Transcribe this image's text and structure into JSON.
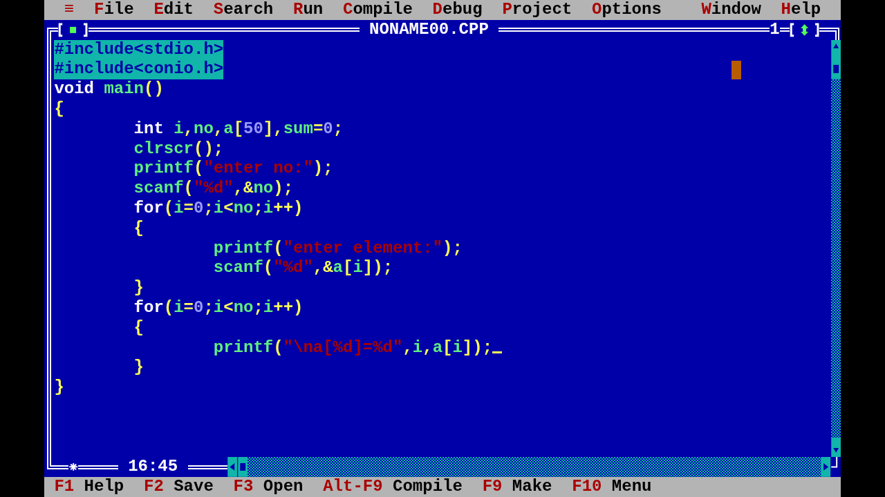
{
  "menu_bar": {
    "items": [
      {
        "label": "≡"
      },
      {
        "label": "File"
      },
      {
        "label": "Edit"
      },
      {
        "label": "Search"
      },
      {
        "label": "Run"
      },
      {
        "label": "Compile"
      },
      {
        "label": "Debug"
      },
      {
        "label": "Project"
      },
      {
        "label": "Options"
      },
      {
        "label": "Window"
      },
      {
        "label": "Help"
      }
    ]
  },
  "window": {
    "title": "NONAME00.CPP",
    "number": "1",
    "modified": true,
    "cursor_position": "16:45"
  },
  "code": {
    "lines": [
      {
        "selected": true,
        "cursor": false,
        "tokens": [
          {
            "kind": "dir",
            "text": "#include<stdio.h>"
          }
        ]
      },
      {
        "selected": true,
        "cursor": false,
        "tokens": [
          {
            "kind": "dir",
            "text": "#include<conio.h>"
          }
        ]
      },
      {
        "selected": false,
        "cursor": false,
        "tokens": [
          {
            "kind": "kw",
            "text": "void"
          },
          {
            "kind": "id",
            "text": " main"
          },
          {
            "kind": "sym",
            "text": "()"
          }
        ]
      },
      {
        "selected": false,
        "cursor": false,
        "tokens": [
          {
            "kind": "sym",
            "text": "{"
          }
        ],
        "children": [
          {
            "selected": false,
            "cursor": false,
            "tokens": [
              {
                "kind": "kw",
                "text": "int"
              },
              {
                "kind": "id",
                "text": " i"
              },
              {
                "kind": "sym",
                "text": ","
              },
              {
                "kind": "id",
                "text": "no"
              },
              {
                "kind": "sym",
                "text": ","
              },
              {
                "kind": "id",
                "text": "a"
              },
              {
                "kind": "sym",
                "text": "["
              },
              {
                "kind": "num",
                "text": "50"
              },
              {
                "kind": "sym",
                "text": "],"
              },
              {
                "kind": "id",
                "text": "sum"
              },
              {
                "kind": "sym",
                "text": "="
              },
              {
                "kind": "num",
                "text": "0"
              },
              {
                "kind": "sym",
                "text": ";"
              }
            ]
          },
          {
            "selected": false,
            "cursor": false,
            "tokens": [
              {
                "kind": "id",
                "text": "clrscr"
              },
              {
                "kind": "sym",
                "text": "();"
              }
            ]
          },
          {
            "selected": false,
            "cursor": false,
            "tokens": [
              {
                "kind": "id",
                "text": "printf"
              },
              {
                "kind": "sym",
                "text": "("
              },
              {
                "kind": "str",
                "text": "\"enter no:\""
              },
              {
                "kind": "sym",
                "text": ");"
              }
            ]
          },
          {
            "selected": false,
            "cursor": false,
            "tokens": [
              {
                "kind": "id",
                "text": "scanf"
              },
              {
                "kind": "sym",
                "text": "("
              },
              {
                "kind": "str",
                "text": "\"%d\""
              },
              {
                "kind": "sym",
                "text": ",&"
              },
              {
                "kind": "id",
                "text": "no"
              },
              {
                "kind": "sym",
                "text": ");"
              }
            ]
          },
          {
            "selected": false,
            "cursor": false,
            "tokens": [
              {
                "kind": "kw",
                "text": "for"
              },
              {
                "kind": "sym",
                "text": "("
              },
              {
                "kind": "id",
                "text": "i"
              },
              {
                "kind": "sym",
                "text": "="
              },
              {
                "kind": "num",
                "text": "0"
              },
              {
                "kind": "sym",
                "text": ";"
              },
              {
                "kind": "id",
                "text": "i"
              },
              {
                "kind": "sym",
                "text": "<"
              },
              {
                "kind": "id",
                "text": "no"
              },
              {
                "kind": "sym",
                "text": ";"
              },
              {
                "kind": "id",
                "text": "i"
              },
              {
                "kind": "sym",
                "text": "++)"
              }
            ]
          },
          {
            "selected": false,
            "cursor": false,
            "tokens": [
              {
                "kind": "sym",
                "text": "{"
              }
            ],
            "children": [
              {
                "selected": false,
                "cursor": false,
                "tokens": [
                  {
                    "kind": "id",
                    "text": "printf"
                  },
                  {
                    "kind": "sym",
                    "text": "("
                  },
                  {
                    "kind": "str",
                    "text": "\"enter element:\""
                  },
                  {
                    "kind": "sym",
                    "text": ");"
                  }
                ]
              },
              {
                "selected": false,
                "cursor": false,
                "tokens": [
                  {
                    "kind": "id",
                    "text": "scanf"
                  },
                  {
                    "kind": "sym",
                    "text": "("
                  },
                  {
                    "kind": "str",
                    "text": "\"%d\""
                  },
                  {
                    "kind": "sym",
                    "text": ",&"
                  },
                  {
                    "kind": "id",
                    "text": "a"
                  },
                  {
                    "kind": "sym",
                    "text": "["
                  },
                  {
                    "kind": "id",
                    "text": "i"
                  },
                  {
                    "kind": "sym",
                    "text": "]);"
                  }
                ]
              }
            ]
          },
          {
            "selected": false,
            "cursor": false,
            "tokens": [
              {
                "kind": "sym",
                "text": "}"
              }
            ]
          },
          {
            "selected": false,
            "cursor": false,
            "tokens": [
              {
                "kind": "kw",
                "text": "for"
              },
              {
                "kind": "sym",
                "text": "("
              },
              {
                "kind": "id",
                "text": "i"
              },
              {
                "kind": "sym",
                "text": "="
              },
              {
                "kind": "num",
                "text": "0"
              },
              {
                "kind": "sym",
                "text": ";"
              },
              {
                "kind": "id",
                "text": "i"
              },
              {
                "kind": "sym",
                "text": "<"
              },
              {
                "kind": "id",
                "text": "no"
              },
              {
                "kind": "sym",
                "text": ";"
              },
              {
                "kind": "id",
                "text": "i"
              },
              {
                "kind": "sym",
                "text": "++)"
              }
            ]
          },
          {
            "selected": false,
            "cursor": false,
            "tokens": [
              {
                "kind": "sym",
                "text": "{"
              }
            ],
            "children": [
              {
                "selected": false,
                "cursor": true,
                "tokens": [
                  {
                    "kind": "id",
                    "text": "printf"
                  },
                  {
                    "kind": "sym",
                    "text": "("
                  },
                  {
                    "kind": "str",
                    "text": "\"\\na[%d]=%d\""
                  },
                  {
                    "kind": "sym",
                    "text": ","
                  },
                  {
                    "kind": "id",
                    "text": "i"
                  },
                  {
                    "kind": "sym",
                    "text": ","
                  },
                  {
                    "kind": "id",
                    "text": "a"
                  },
                  {
                    "kind": "sym",
                    "text": "["
                  },
                  {
                    "kind": "id",
                    "text": "i"
                  },
                  {
                    "kind": "sym",
                    "text": "]);"
                  }
                ]
              }
            ]
          },
          {
            "selected": false,
            "cursor": false,
            "tokens": [
              {
                "kind": "sym",
                "text": "}"
              }
            ]
          }
        ]
      },
      {
        "selected": false,
        "cursor": false,
        "tokens": [
          {
            "kind": "sym",
            "text": "}"
          }
        ]
      }
    ]
  },
  "status_bar": {
    "items": [
      {
        "key": "F1",
        "label": "Help"
      },
      {
        "key": "F2",
        "label": "Save"
      },
      {
        "key": "F3",
        "label": "Open"
      },
      {
        "key": "Alt-F9",
        "label": "Compile"
      },
      {
        "key": "F9",
        "label": "Make"
      },
      {
        "key": "F10",
        "label": "Menu"
      }
    ]
  }
}
